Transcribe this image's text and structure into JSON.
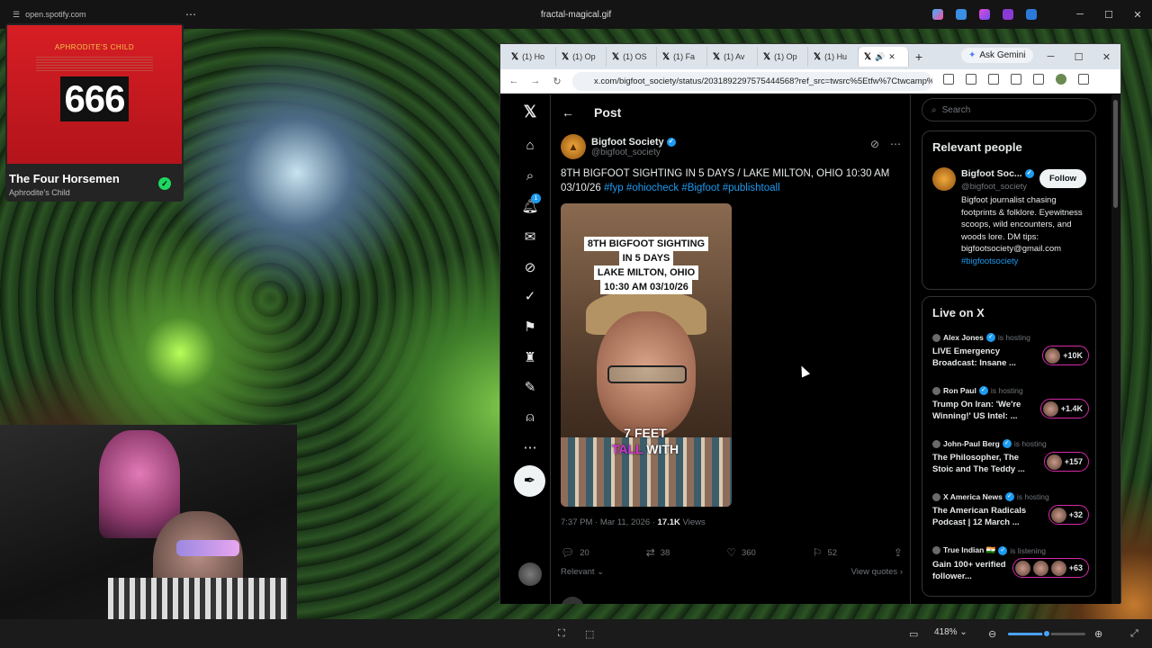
{
  "viewer": {
    "title": "fractal-magical.gif",
    "mini_url": "open.spotify.com",
    "zoom": "418%"
  },
  "spotify": {
    "album_artist": "APHRODITE'S CHILD",
    "album_number": "666",
    "track_title": "The Four Horsemen",
    "track_artist": "Aphrodite's Child"
  },
  "browser": {
    "tabs": [
      {
        "label": "(1) Ho"
      },
      {
        "label": "(1) Op"
      },
      {
        "label": "(1) OS"
      },
      {
        "label": "(1) Fa"
      },
      {
        "label": "(1) Av"
      },
      {
        "label": "(1) Op"
      },
      {
        "label": "(1) Hu"
      },
      {
        "label": ""
      }
    ],
    "gemini_label": "Ask Gemini",
    "url": "x.com/bigfoot_society/status/2031892297575444568?ref_src=twsrc%5Etfw%7Ctwcamp%5E..."
  },
  "post": {
    "header_title": "Post",
    "author_name": "Bigfoot Society",
    "author_handle": "@bigfoot_society",
    "text_main": "8TH BIGFOOT SIGHTING IN 5 DAYS / LAKE MILTON, OHIO 10:30 AM 03/10/26",
    "hashtags": [
      "#fyp",
      "#ohiocheck",
      "#Bigfoot",
      "#publishtoall"
    ],
    "video_caption_lines": [
      "8TH BIGFOOT SIGHTING",
      "IN 5 DAYS",
      "LAKE MILTON, OHIO",
      "10:30 AM 03/10/26"
    ],
    "video_subtitle_1": "7 FEET",
    "video_subtitle_2a": "TALL",
    "video_subtitle_2b": " WITH",
    "timestamp": "7:37 PM · Mar 11, 2026 · ",
    "views_count": "17.1K",
    "views_label": " Views",
    "replies": "20",
    "reposts": "38",
    "likes": "360",
    "bookmarks": "52",
    "sort_label": "Relevant",
    "view_quotes": "View quotes"
  },
  "nav": {
    "notif_badge": "1"
  },
  "sidebar": {
    "search_placeholder": "Search",
    "relevant_title": "Relevant people",
    "rp_name": "Bigfoot Soc...",
    "rp_handle": "@bigfoot_society",
    "follow_label": "Follow",
    "rp_bio": "Bigfoot journalist chasing footprints & folklore. Eyewitness scoops, wild encounters, and woods lore. DM tips: bigfootsociety@gmail.com",
    "rp_bio_tag": "#bigfootsociety",
    "live_title": "Live on X",
    "live": [
      {
        "host": "Alex Jones",
        "status": "is hosting",
        "title": "LIVE Emergency Broadcast: Insane ...",
        "count": "+10K"
      },
      {
        "host": "Ron Paul",
        "status": "is hosting",
        "title": "Trump On Iran: 'We're Winning!' US Intel: ...",
        "count": "+1.4K"
      },
      {
        "host": "John-Paul Berg",
        "status": "is hosting",
        "title": "The Philosopher, The Stoic and The Teddy ...",
        "count": "+157"
      },
      {
        "host": "X America News",
        "status": "is hosting",
        "title": "The American Radicals Podcast | 12 March ...",
        "count": "+32"
      },
      {
        "host": "True Indian 🇮🇳",
        "status": "is listening",
        "title": "Gain 100+ verified follower...",
        "count": "+63"
      }
    ]
  },
  "colors": {
    "accent": "#1d9bf0",
    "spotify_green": "#1ed760",
    "live_ring": "#d52aa8"
  }
}
